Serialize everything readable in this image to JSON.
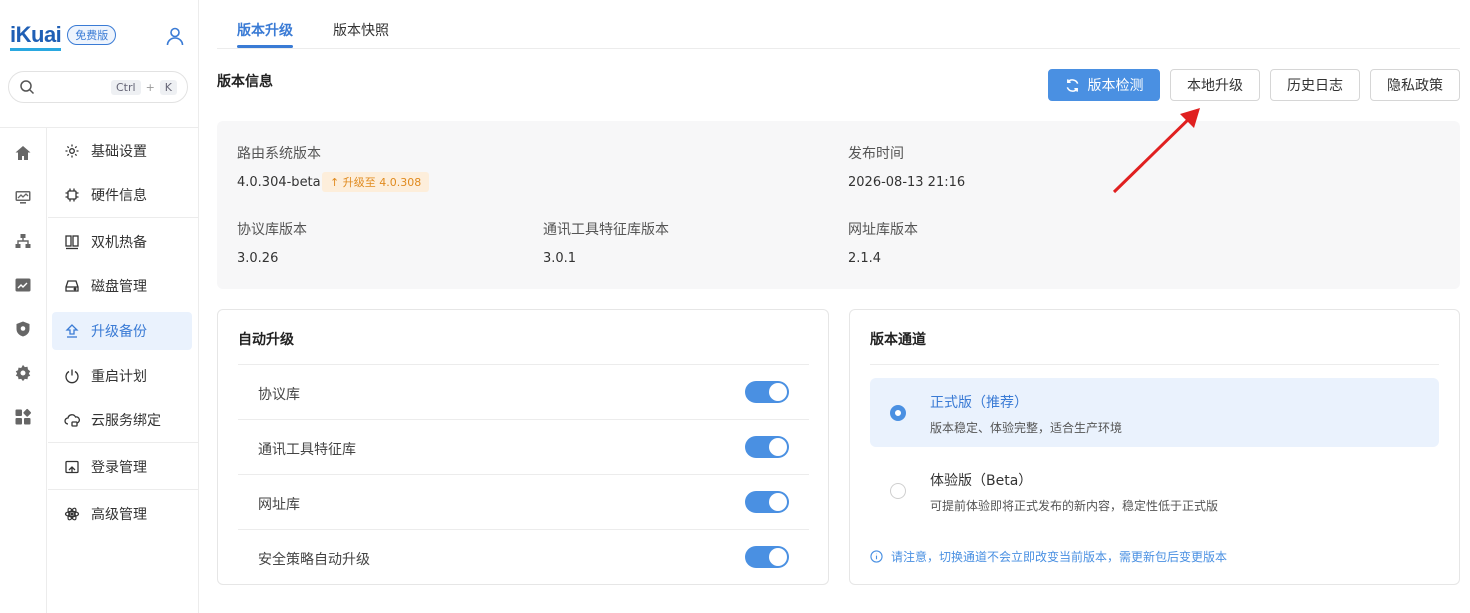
{
  "brand": {
    "logo": "iKuai",
    "edition": "免费版"
  },
  "search": {
    "key1": "Ctrl",
    "plus": "+",
    "key2": "K"
  },
  "menu": {
    "items": [
      {
        "label": "基础设置",
        "icon": "gear-icon"
      },
      {
        "label": "硬件信息",
        "icon": "chip-icon"
      },
      {
        "label": "双机热备",
        "icon": "dual-server-icon"
      },
      {
        "label": "磁盘管理",
        "icon": "disk-icon"
      },
      {
        "label": "升级备份",
        "icon": "upgrade-icon"
      },
      {
        "label": "重启计划",
        "icon": "power-icon"
      },
      {
        "label": "云服务绑定",
        "icon": "cloud-lock-icon"
      },
      {
        "label": "登录管理",
        "icon": "login-icon"
      },
      {
        "label": "高级管理",
        "icon": "atom-icon"
      }
    ]
  },
  "tabs": [
    {
      "label": "版本升级"
    },
    {
      "label": "版本快照"
    }
  ],
  "section": {
    "title": "版本信息"
  },
  "actions": {
    "check": "版本检测",
    "local": "本地升级",
    "history": "历史日志",
    "privacy": "隐私政策"
  },
  "info": {
    "router_label": "路由系统版本",
    "router_value": "4.0.304-beta",
    "upgrade_tag": "↑ 升级至 4.0.308",
    "release_label": "发布时间",
    "release_value": "2026-08-13 21:16",
    "protocol_label": "协议库版本",
    "protocol_value": "3.0.26",
    "comm_label": "通讯工具特征库版本",
    "comm_value": "3.0.1",
    "url_label": "网址库版本",
    "url_value": "2.1.4"
  },
  "auto": {
    "title": "自动升级",
    "rows": [
      {
        "label": "协议库",
        "on": true
      },
      {
        "label": "通讯工具特征库",
        "on": true
      },
      {
        "label": "网址库",
        "on": true
      },
      {
        "label": "安全策略自动升级",
        "on": true
      }
    ]
  },
  "channel": {
    "title": "版本通道",
    "options": [
      {
        "title": "正式版（推荐）",
        "desc": "版本稳定、体验完整，适合生产环境",
        "selected": true
      },
      {
        "title": "体验版（Beta）",
        "desc": "可提前体验即将正式发布的新内容，稳定性低于正式版",
        "selected": false
      }
    ],
    "notice": "请注意，切换通道不会立即改变当前版本，需更新包后变更版本"
  },
  "colors": {
    "accent": "#4a90e2",
    "tag_bg": "#fdeedb",
    "tag_text": "#e08a1e",
    "arrow": "#e02020"
  }
}
